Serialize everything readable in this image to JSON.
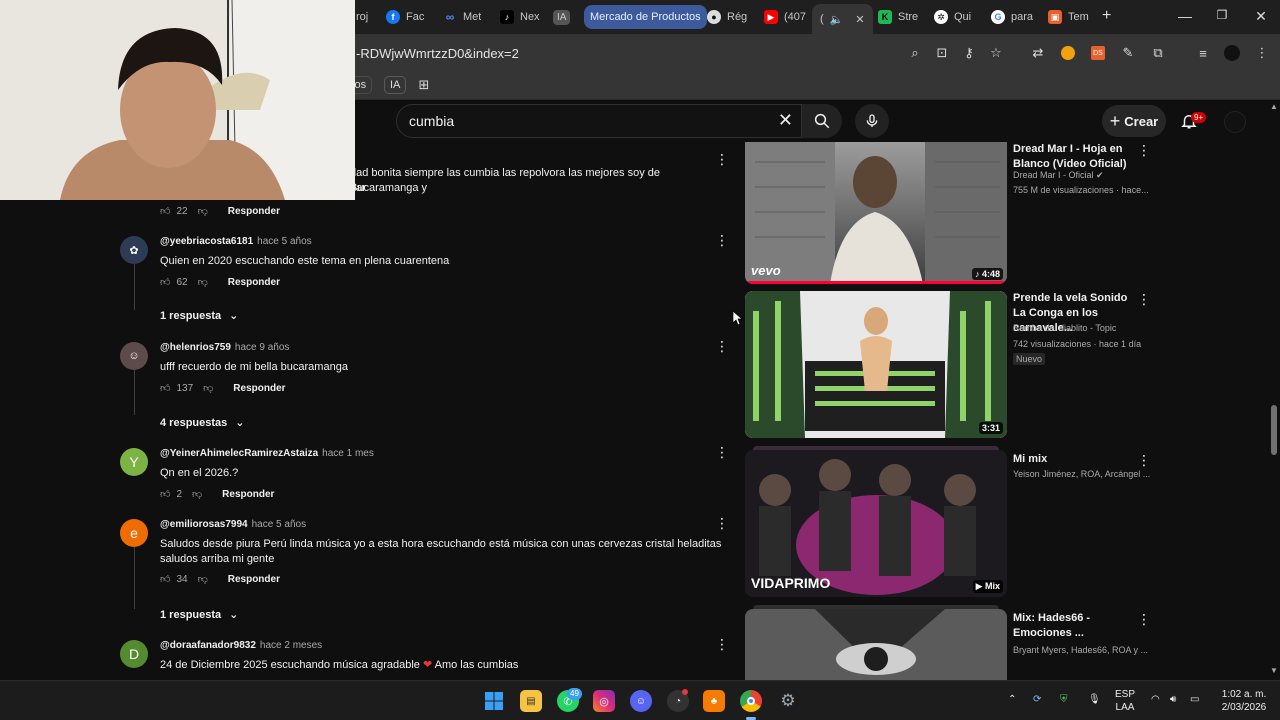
{
  "browser": {
    "tabs": [
      {
        "label": "Fac",
        "icon": "facebook-icon"
      },
      {
        "label": "Met",
        "icon": "meta-icon"
      },
      {
        "label": "Nex",
        "icon": "tiktok-icon"
      },
      {
        "label": "IA",
        "icon": "ia-icon"
      },
      {
        "label": "Mercado de Productos",
        "icon": "group-chip"
      },
      {
        "label": "Rég",
        "icon": "github-icon"
      },
      {
        "label": "(407",
        "icon": "youtube-icon"
      },
      {
        "label": "(",
        "icon": "audio-icon"
      },
      {
        "label": "Stre",
        "icon": "kick-icon"
      },
      {
        "label": "Qui",
        "icon": "openai-icon"
      },
      {
        "label": "para",
        "icon": "google-icon"
      },
      {
        "label": "Tem",
        "icon": "app-icon"
      }
    ],
    "first_tab_fragment": "roj",
    "url": "-RDWjwWmrtzzD0&index=2",
    "bookmarks": {
      "chip1": "ctos",
      "chip2": "IA"
    },
    "colors": {
      "pill": "#3d5a9c"
    }
  },
  "youtube": {
    "search_value": "cumbia",
    "create_label": "Crear",
    "notification_badge": "9+"
  },
  "comments": [
    {
      "author": "",
      "time": "",
      "text": "dad bonita siempre las cumbia las repolvora las mejores soy de Bucaramanga y",
      "text2": "oar",
      "likes": "22",
      "reply_label": "Responder"
    },
    {
      "author": "@yeebriacosta6181",
      "time": "hace 5 años",
      "text": "Quien en 2020 escuchando este tema en plena cuarentena",
      "likes": "62",
      "reply_label": "Responder",
      "replies": "1 respuesta"
    },
    {
      "author": "@helenrios759",
      "time": "hace 9 años",
      "text": "ufff recuerdo de mi bella bucaramanga",
      "likes": "137",
      "reply_label": "Responder",
      "replies": "4 respuestas"
    },
    {
      "author": "@YeinerAhimelecRamirezAstaiza",
      "time": "hace 1 mes",
      "text": "Qn en el 2026.?",
      "likes": "2",
      "reply_label": "Responder",
      "avatar_letter": "Y",
      "avatar_color": "#7cb342"
    },
    {
      "author": "@emiliorosas7994",
      "time": "hace 5 años",
      "text": "Saludos desde piura Perú linda música yo a esta hora escuchando está música con unas cervezas cristal heladitas saludos arriba mi gente",
      "likes": "34",
      "reply_label": "Responder",
      "replies": "1 respuesta",
      "avatar_letter": "e",
      "avatar_color": "#ef6c00"
    },
    {
      "author": "@doraafanador9832",
      "time": "hace 2 meses",
      "text": "24 de Diciembre 2025 escuchando música agradable",
      "text_after": "Amo las cumbias",
      "avatar_letter": "D",
      "avatar_color": "#558b2f"
    }
  ],
  "videos": [
    {
      "title": "Dread Mar I - Hoja en Blanco (Video Oficial)",
      "channel": "Dread Mar I - Oficial",
      "stats": "755 M de visualizaciones · hace...",
      "duration": "4:48",
      "logo": "vevo"
    },
    {
      "title": "Prende la vela Sonido La Conga en los carnavale...",
      "channel": "Rumba del diablito - Topic",
      "stats": "742 visualizaciones · hace 1 día",
      "badge": "Nuevo",
      "duration": "3:31"
    },
    {
      "title": "Mi mix",
      "channel": "Yeison Jiménez, ROA, Arcángel ...",
      "duration": "Mix",
      "logo": "VIDAPRIMO"
    },
    {
      "title": "Mix: Hades66 - Emociones ...",
      "channel": "Bryant Myers, Hades66, ROA y ..."
    }
  ],
  "taskbar": {
    "whatsapp_badge": "49",
    "language": "ESP",
    "layout": "LAA",
    "time": "1:02 a. m.",
    "date": "2/03/2026"
  }
}
